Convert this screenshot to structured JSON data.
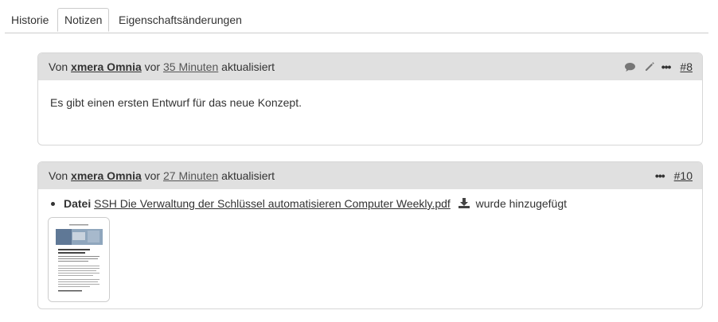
{
  "tabs": [
    {
      "label": "Historie"
    },
    {
      "label": "Notizen"
    },
    {
      "label": "Eigenschaftsänderungen"
    }
  ],
  "journals": [
    {
      "prefix": "Von",
      "author": "xmera Omnia",
      "middle": "vor",
      "time": "35 Minuten",
      "suffix": "aktualisiert",
      "number": "#8",
      "note": "Es gibt einen ersten Entwurf für das neue Konzept."
    },
    {
      "prefix": "Von",
      "author": "xmera Omnia",
      "middle": "vor",
      "time": "27 Minuten",
      "suffix": "aktualisiert",
      "number": "#10",
      "detail_label": "Datei",
      "detail_file": "SSH Die Verwaltung der Schlüssel automatisieren Computer Weekly.pdf",
      "detail_suffix": "wurde hinzugefügt"
    }
  ],
  "icons": {
    "quote": "speech-bubble-icon",
    "edit": "pencil-icon",
    "more": "ellipsis-icon",
    "download": "download-icon"
  },
  "colors": {
    "header_bg": "#e0e0e0",
    "border": "#d7d7d7",
    "text": "#333333"
  }
}
